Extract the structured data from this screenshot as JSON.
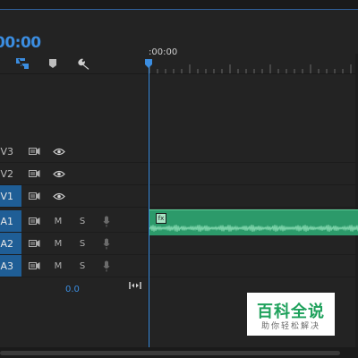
{
  "timeline": {
    "timecode": "00:00",
    "ruler_time": ":00:00"
  },
  "toolbar": {
    "snap_icon": "snap-icon",
    "marker_icon": "marker-icon",
    "settings_icon": "wrench-icon"
  },
  "video_tracks": [
    {
      "name": "V3"
    },
    {
      "name": "V2"
    },
    {
      "name": "V1"
    }
  ],
  "audio_tracks": [
    {
      "name": "A1",
      "mute": "M",
      "solo": "S"
    },
    {
      "name": "A2",
      "mute": "M",
      "solo": "S"
    },
    {
      "name": "A3",
      "mute": "M",
      "solo": "S"
    }
  ],
  "master": {
    "volume": "0.0"
  },
  "clip": {
    "badge": "fx"
  },
  "watermark": {
    "title": "百科全说",
    "subtitle": "助你轻松解决"
  },
  "colors": {
    "accent": "#3b8de0",
    "track_active": "#1f5e96",
    "audio_clip": "#2c9a6a"
  }
}
